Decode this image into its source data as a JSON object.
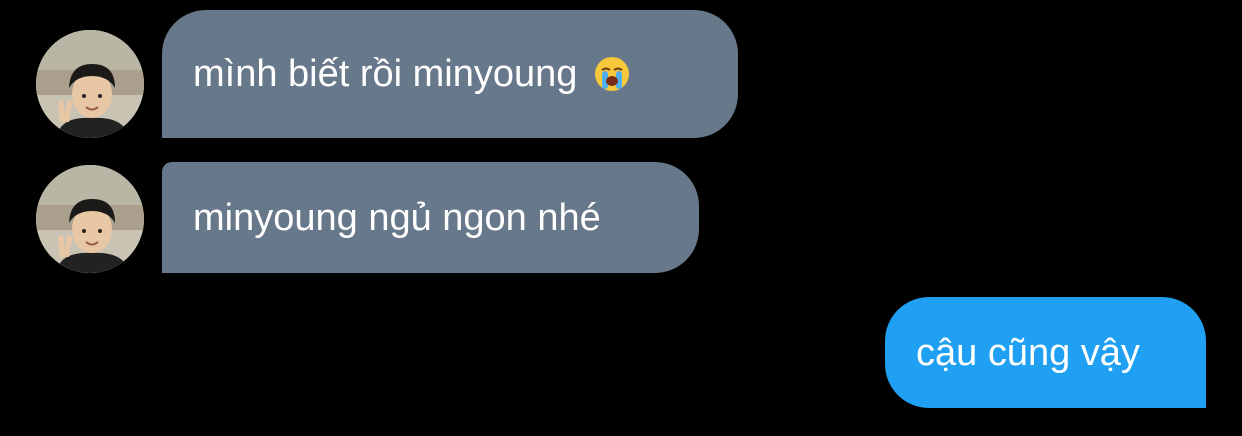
{
  "messages": [
    {
      "sender": "other",
      "text": "mình biết rồi minyoung",
      "emoji": "loudly-crying-face-icon"
    },
    {
      "sender": "other",
      "text": "minyoung ngủ ngon nhé"
    },
    {
      "sender": "me",
      "text": "cậu cũng vậy"
    }
  ],
  "colors": {
    "background": "#000000",
    "incoming_bubble": "#667889",
    "outgoing_bubble": "#1fa0f2",
    "text": "#ffffff"
  }
}
